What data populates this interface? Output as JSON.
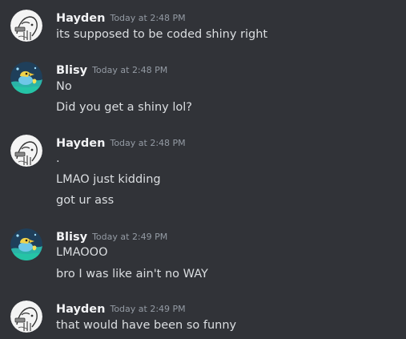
{
  "messages": [
    {
      "author": "Hayden",
      "avatar": "sketch-avatar",
      "timestamp": "Today at 2:48 PM",
      "lines": [
        "its supposed to be coded shiny right"
      ]
    },
    {
      "author": "Blisy",
      "avatar": "teal-bird-avatar",
      "timestamp": "Today at 2:48 PM",
      "lines": [
        "No",
        "Did you get a shiny lol?"
      ]
    },
    {
      "author": "Hayden",
      "avatar": "sketch-avatar",
      "timestamp": "Today at 2:48 PM",
      "lines": [
        ".",
        "LMAO just kidding",
        "got ur ass"
      ]
    },
    {
      "author": "Blisy",
      "avatar": "teal-bird-avatar",
      "timestamp": "Today at 2:49 PM",
      "lines": [
        "LMAOOO",
        "bro I was like ain't no WAY"
      ]
    },
    {
      "author": "Hayden",
      "avatar": "sketch-avatar",
      "timestamp": "Today at 2:49 PM",
      "lines": [
        "that would have been so funny"
      ]
    }
  ],
  "colors": {
    "background": "#313338",
    "username": "#f2f3f5",
    "text": "#dbdee1",
    "timestamp": "#949ba4"
  }
}
